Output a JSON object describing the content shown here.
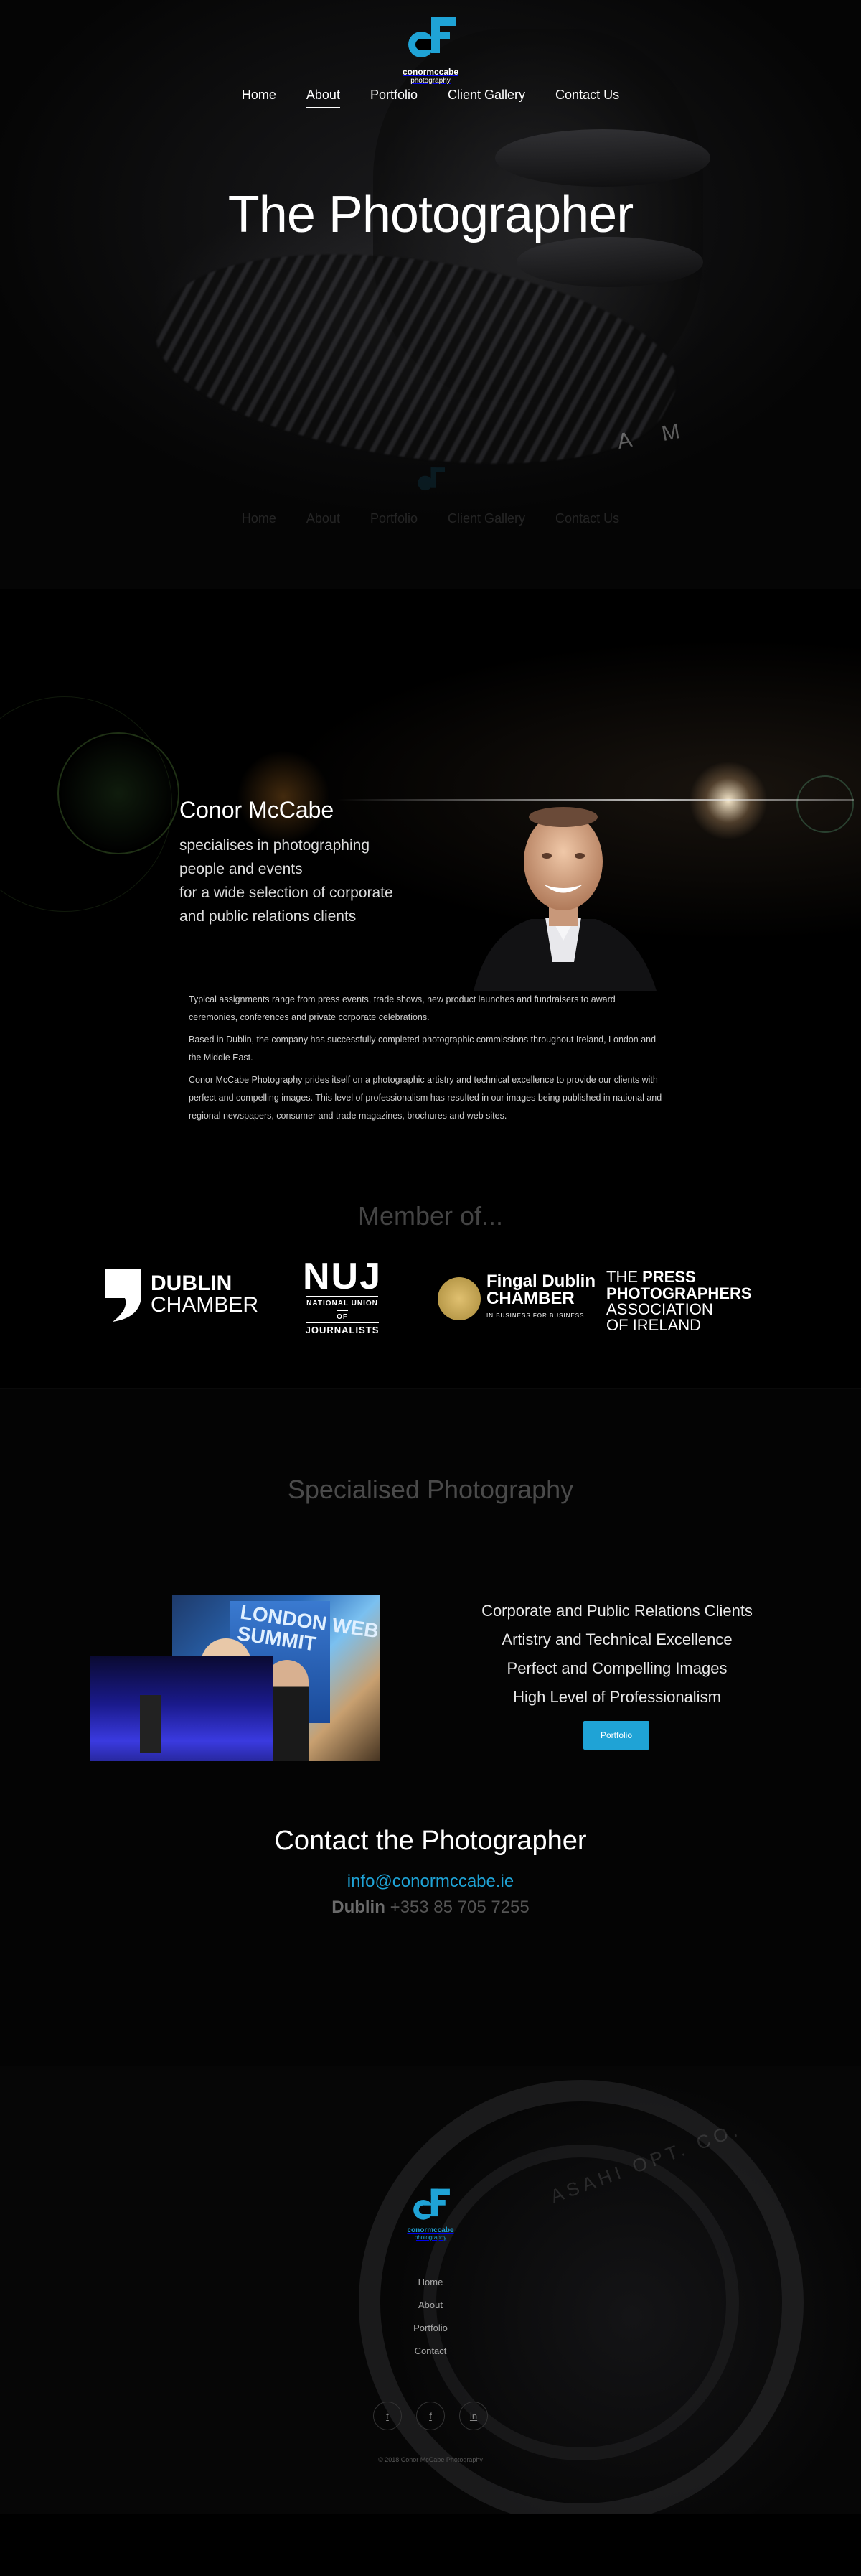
{
  "brand": {
    "name": "conormccabe",
    "sub": "photography",
    "color": "#1fa3d6"
  },
  "nav": {
    "items": [
      {
        "label": "Home"
      },
      {
        "label": "About"
      },
      {
        "label": "Portfolio"
      },
      {
        "label": "Client Gallery"
      },
      {
        "label": "Contact Us"
      }
    ],
    "active": "About"
  },
  "hero": {
    "title": "The Photographer",
    "lens_text": "A M"
  },
  "profile": {
    "name": "Conor McCabe",
    "lines": [
      "specialises in photographing",
      "people and events",
      "for a wide selection of corporate",
      "and public relations clients"
    ]
  },
  "about": {
    "paragraphs": [
      "Typical assignments range from press events, trade shows, new product launches and fundraisers to award ceremonies, conferences and private corporate celebrations.",
      "Based in Dublin, the company has successfully completed photographic commissions throughout Ireland, London and the Middle East.",
      "Conor McCabe Photography prides itself on a photographic artistry and technical excellence to provide our clients with perfect and compelling images. This level of professionalism has resulted in our images being published in national and regional newspapers, consumer and trade magazines, brochures and web sites."
    ]
  },
  "members": {
    "heading": "Member of...",
    "dublin": {
      "line1": "DUBLIN",
      "line2": "CHAMBER"
    },
    "nuj": {
      "big": "NUJ",
      "l1": "NATIONAL UNION",
      "l2": "OF",
      "l3": "JOURNALISTS"
    },
    "fingal": {
      "line1": "Fingal Dublin",
      "line2": "CHAMBER",
      "line3": "IN BUSINESS FOR BUSINESS"
    },
    "ppai": {
      "l1a": "THE ",
      "l1b": "PRESS",
      "l2": "PHOTOGRAPHERS",
      "l3": "ASSOCIATION",
      "l4": "OF IRELAND"
    }
  },
  "special": {
    "heading": "Specialised Photography",
    "items": [
      "Corporate and Public Relations Clients",
      "Artistry and Technical Excellence",
      "Perfect and Compelling Images",
      "High Level of Professionalism"
    ],
    "button": "Portfolio",
    "photo_screen_text": "LONDON WEB SUMMIT"
  },
  "contact": {
    "heading": "Contact the Photographer",
    "email": "info@conormccabe.ie",
    "phone_city": "Dublin",
    "phone_number": "+353 85 705 7255"
  },
  "footer": {
    "nav": [
      {
        "label": "Home"
      },
      {
        "label": "About"
      },
      {
        "label": "Portfolio"
      },
      {
        "label": "Contact"
      }
    ],
    "socials": [
      {
        "icon": "twitter-icon",
        "glyph": "t"
      },
      {
        "icon": "facebook-icon",
        "glyph": "f"
      },
      {
        "icon": "linkedin-icon",
        "glyph": "in"
      }
    ],
    "copyright": "© 2018 Conor McCabe Photography",
    "lens_text": "ASAHI OPT. CO."
  }
}
